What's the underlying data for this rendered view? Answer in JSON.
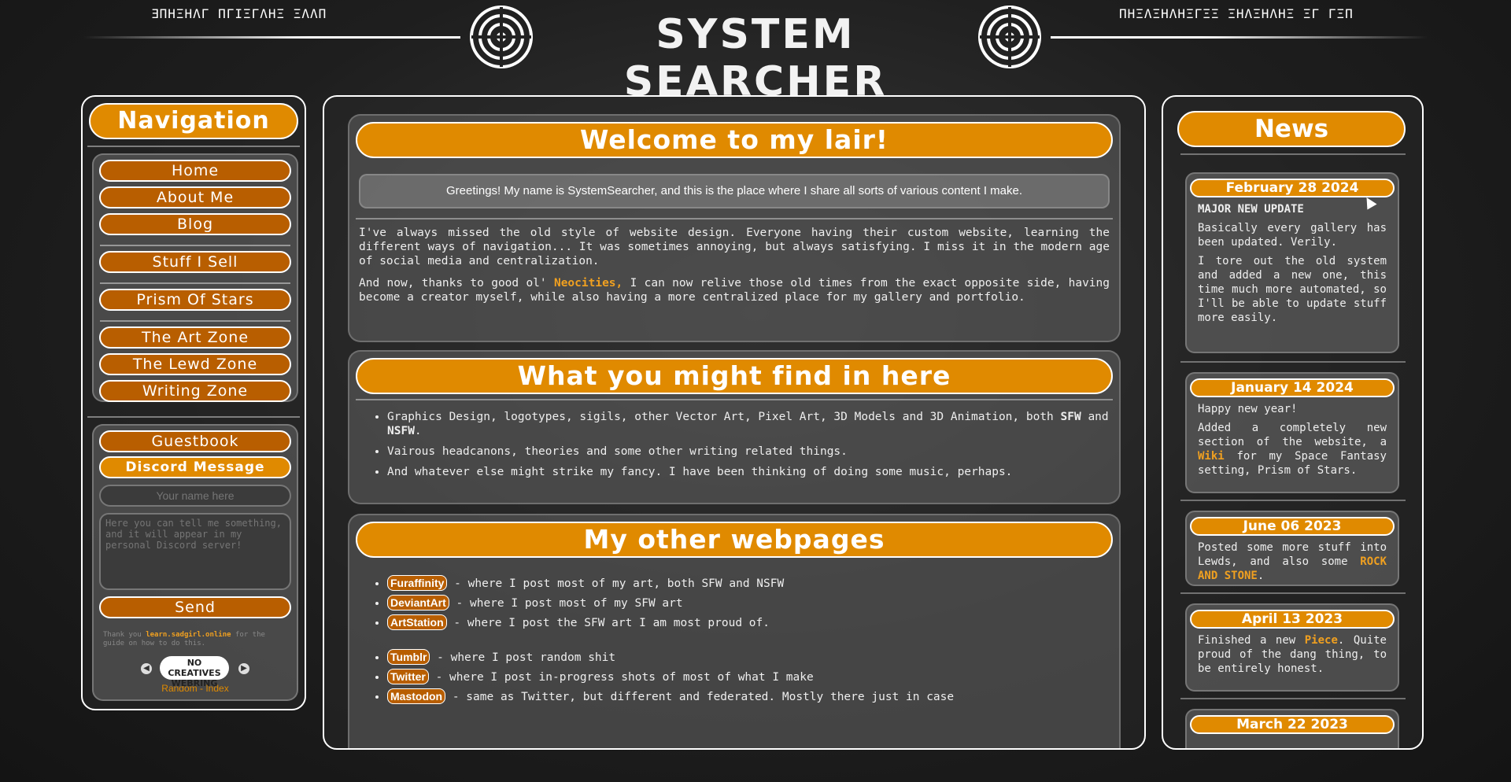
{
  "header": {
    "title": "SYSTEM SEARCHER",
    "glyph_left": "ƎΠHΞΗΛΓ ΠΓΙΞΓΛΗΞ ΞΛΛΠ",
    "glyph_right": "ΠΗΞΛΞΗΛΗΞΓΞΞ ΞΗΛΞΗΛΗΞ ΞΓ ΓΞΠ",
    "emblem_icon": "emblem-icon"
  },
  "nav": {
    "title": "Navigation",
    "group1": [
      "Home",
      "About Me",
      "Blog"
    ],
    "group2": [
      "Stuff I Sell"
    ],
    "group3": [
      "Prism Of Stars"
    ],
    "group4": [
      "The Art Zone",
      "The Lewd Zone",
      "Writing Zone"
    ]
  },
  "guestbook": {
    "guestbook_label": "Guestbook",
    "discord_label": "Discord Message",
    "name_placeholder": "Your name here",
    "message_placeholder": "Here you can tell me something, and it will appear in my personal Discord server!",
    "send_label": "Send",
    "thanks_prefix": "Thank you ",
    "thanks_link": "learn.sadgirl.online",
    "thanks_suffix": " for the guide on how to do this.",
    "webring_badge": "NO CREATIVES WEBRING",
    "random_label": "Random",
    "dash": "-",
    "index_label": "Index"
  },
  "main": {
    "welcome_title": "Welcome to my lair!",
    "greeting": "Greetings! My name is SystemSearcher, and this is the place where I share all sorts of various content I make.",
    "para1": "I've always missed the old style of website design. Everyone having their custom website, learning the different ways of navigation... It was sometimes annoying, but always satisfying. I miss it in the modern age of social media and centralization.",
    "para2_a": "And now, thanks to good ol' ",
    "para2_link": "Neocities,",
    "para2_b": " I can now relive those old times from the exact opposite side, having become a creator myself, while also having a more centralized place for my gallery and portfolio.",
    "find_title": "What you might find in here",
    "find1_a": "Graphics Design, logotypes, sigils, other Vector Art, Pixel Art, 3D Models and 3D Animation, both ",
    "find1_sfw": "SFW",
    "find1_and": " and ",
    "find1_nsfw": "NSFW",
    "find1_end": ".",
    "find2": "Vairous headcanons, theories and some other writing related things.",
    "find3": "And whatever else might strike my fancy. I have been thinking of doing some music, perhaps.",
    "other_title": "My other webpages",
    "links": [
      {
        "name": "Furaffinity",
        "desc": " - where I post most of my art, both SFW and NSFW"
      },
      {
        "name": "DeviantArt",
        "desc": " - where I post most of my SFW art"
      },
      {
        "name": "ArtStation",
        "desc": " - where I post the SFW art I am most proud of."
      },
      {
        "name": "Tumblr",
        "desc": " - where I post random shit"
      },
      {
        "name": "Twitter",
        "desc": " - where I post in-progress shots of most of what I make"
      },
      {
        "name": "Mastodon",
        "desc": " - same as Twitter, but different and federated. Mostly there just in case"
      }
    ]
  },
  "news": {
    "title": "News",
    "items": [
      {
        "date": "February 28 2024",
        "headline": "MAJOR NEW UPDATE",
        "p1": "Basically every gallery has been updated. Verily.",
        "p2": "I tore out the old system and added a new one, this time much more automated, so I'll be able to update stuff more easily."
      },
      {
        "date": "January 14 2024",
        "p1": "Happy new year!",
        "p2_a": "Added a completely new section of the website, a ",
        "p2_link": "Wiki",
        "p2_b": " for my Space Fantasy setting, Prism of Stars."
      },
      {
        "date": "June 06 2023",
        "p1_a": "Posted some more stuff into Lewds, and also some ",
        "p1_link": "ROCK AND STONE",
        "p1_b": "."
      },
      {
        "date": "April 13 2023",
        "p1_a": "Finished a new ",
        "p1_link": "Piece",
        "p1_b": ". Quite proud of the dang thing, to be entirely honest."
      },
      {
        "date": "March 22 2023"
      }
    ]
  }
}
